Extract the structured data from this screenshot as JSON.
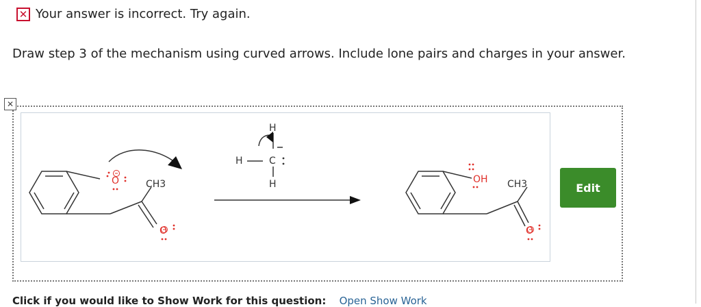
{
  "feedback": {
    "icon": "x-mark-icon",
    "icon_glyph": "✕",
    "text": "Your answer is incorrect.  Try again."
  },
  "question": {
    "text": "Draw step 3 of the mechanism using curved arrows. Include lone pairs and charges in your answer."
  },
  "drawing": {
    "corner_icon_glyph": "✕",
    "labels": {
      "ch3_left": "CH3",
      "reagent_h_left": "H",
      "reagent_c": "C",
      "reagent_h_top": "H",
      "reagent_h_bottom": "H",
      "oh": "OH",
      "ch3_right": "CH3"
    },
    "colors": {
      "oxygen": "#e0302a",
      "bond": "#333333",
      "frame": "#c9d3dc"
    }
  },
  "edit_button": {
    "label": "Edit",
    "color": "#3b8c2a"
  },
  "footer": {
    "text": "Click if you would like to Show Work for this question:",
    "link": "Open Show Work"
  }
}
